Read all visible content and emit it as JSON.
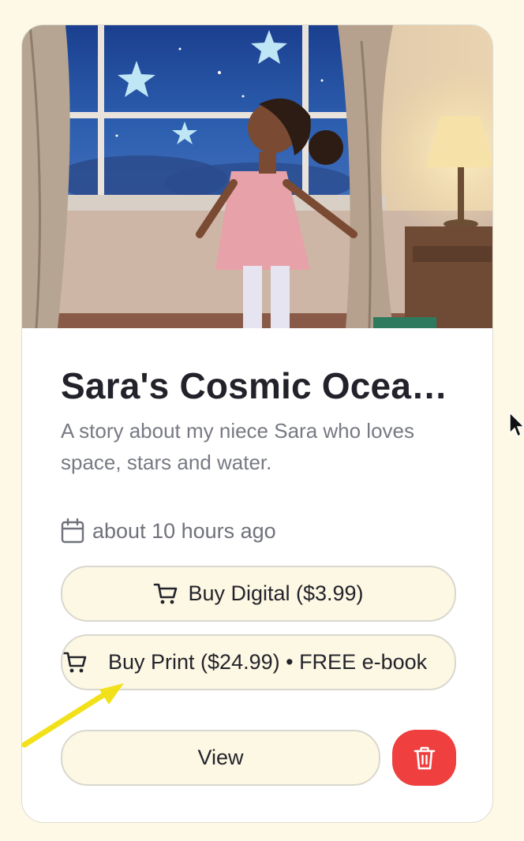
{
  "card": {
    "title": "Sara's Cosmic Ocean Adventure",
    "description": "A story about my niece Sara who loves space, stars and water.",
    "date": "about 10 hours ago",
    "image_icon": "cover-illustration"
  },
  "buttons": {
    "buy_digital": "Buy Digital ($3.99)",
    "buy_print": "Buy Print ($24.99) • FREE e-book",
    "view": "View",
    "delete_icon": "trash-icon"
  },
  "icons": {
    "calendar": "calendar-icon",
    "cart": "cart-icon"
  },
  "colors": {
    "page_bg": "#fdf9e6",
    "button_bg": "#fdf8e3",
    "delete_red": "#ef3f3f",
    "annotation_arrow": "#f2e11a"
  }
}
